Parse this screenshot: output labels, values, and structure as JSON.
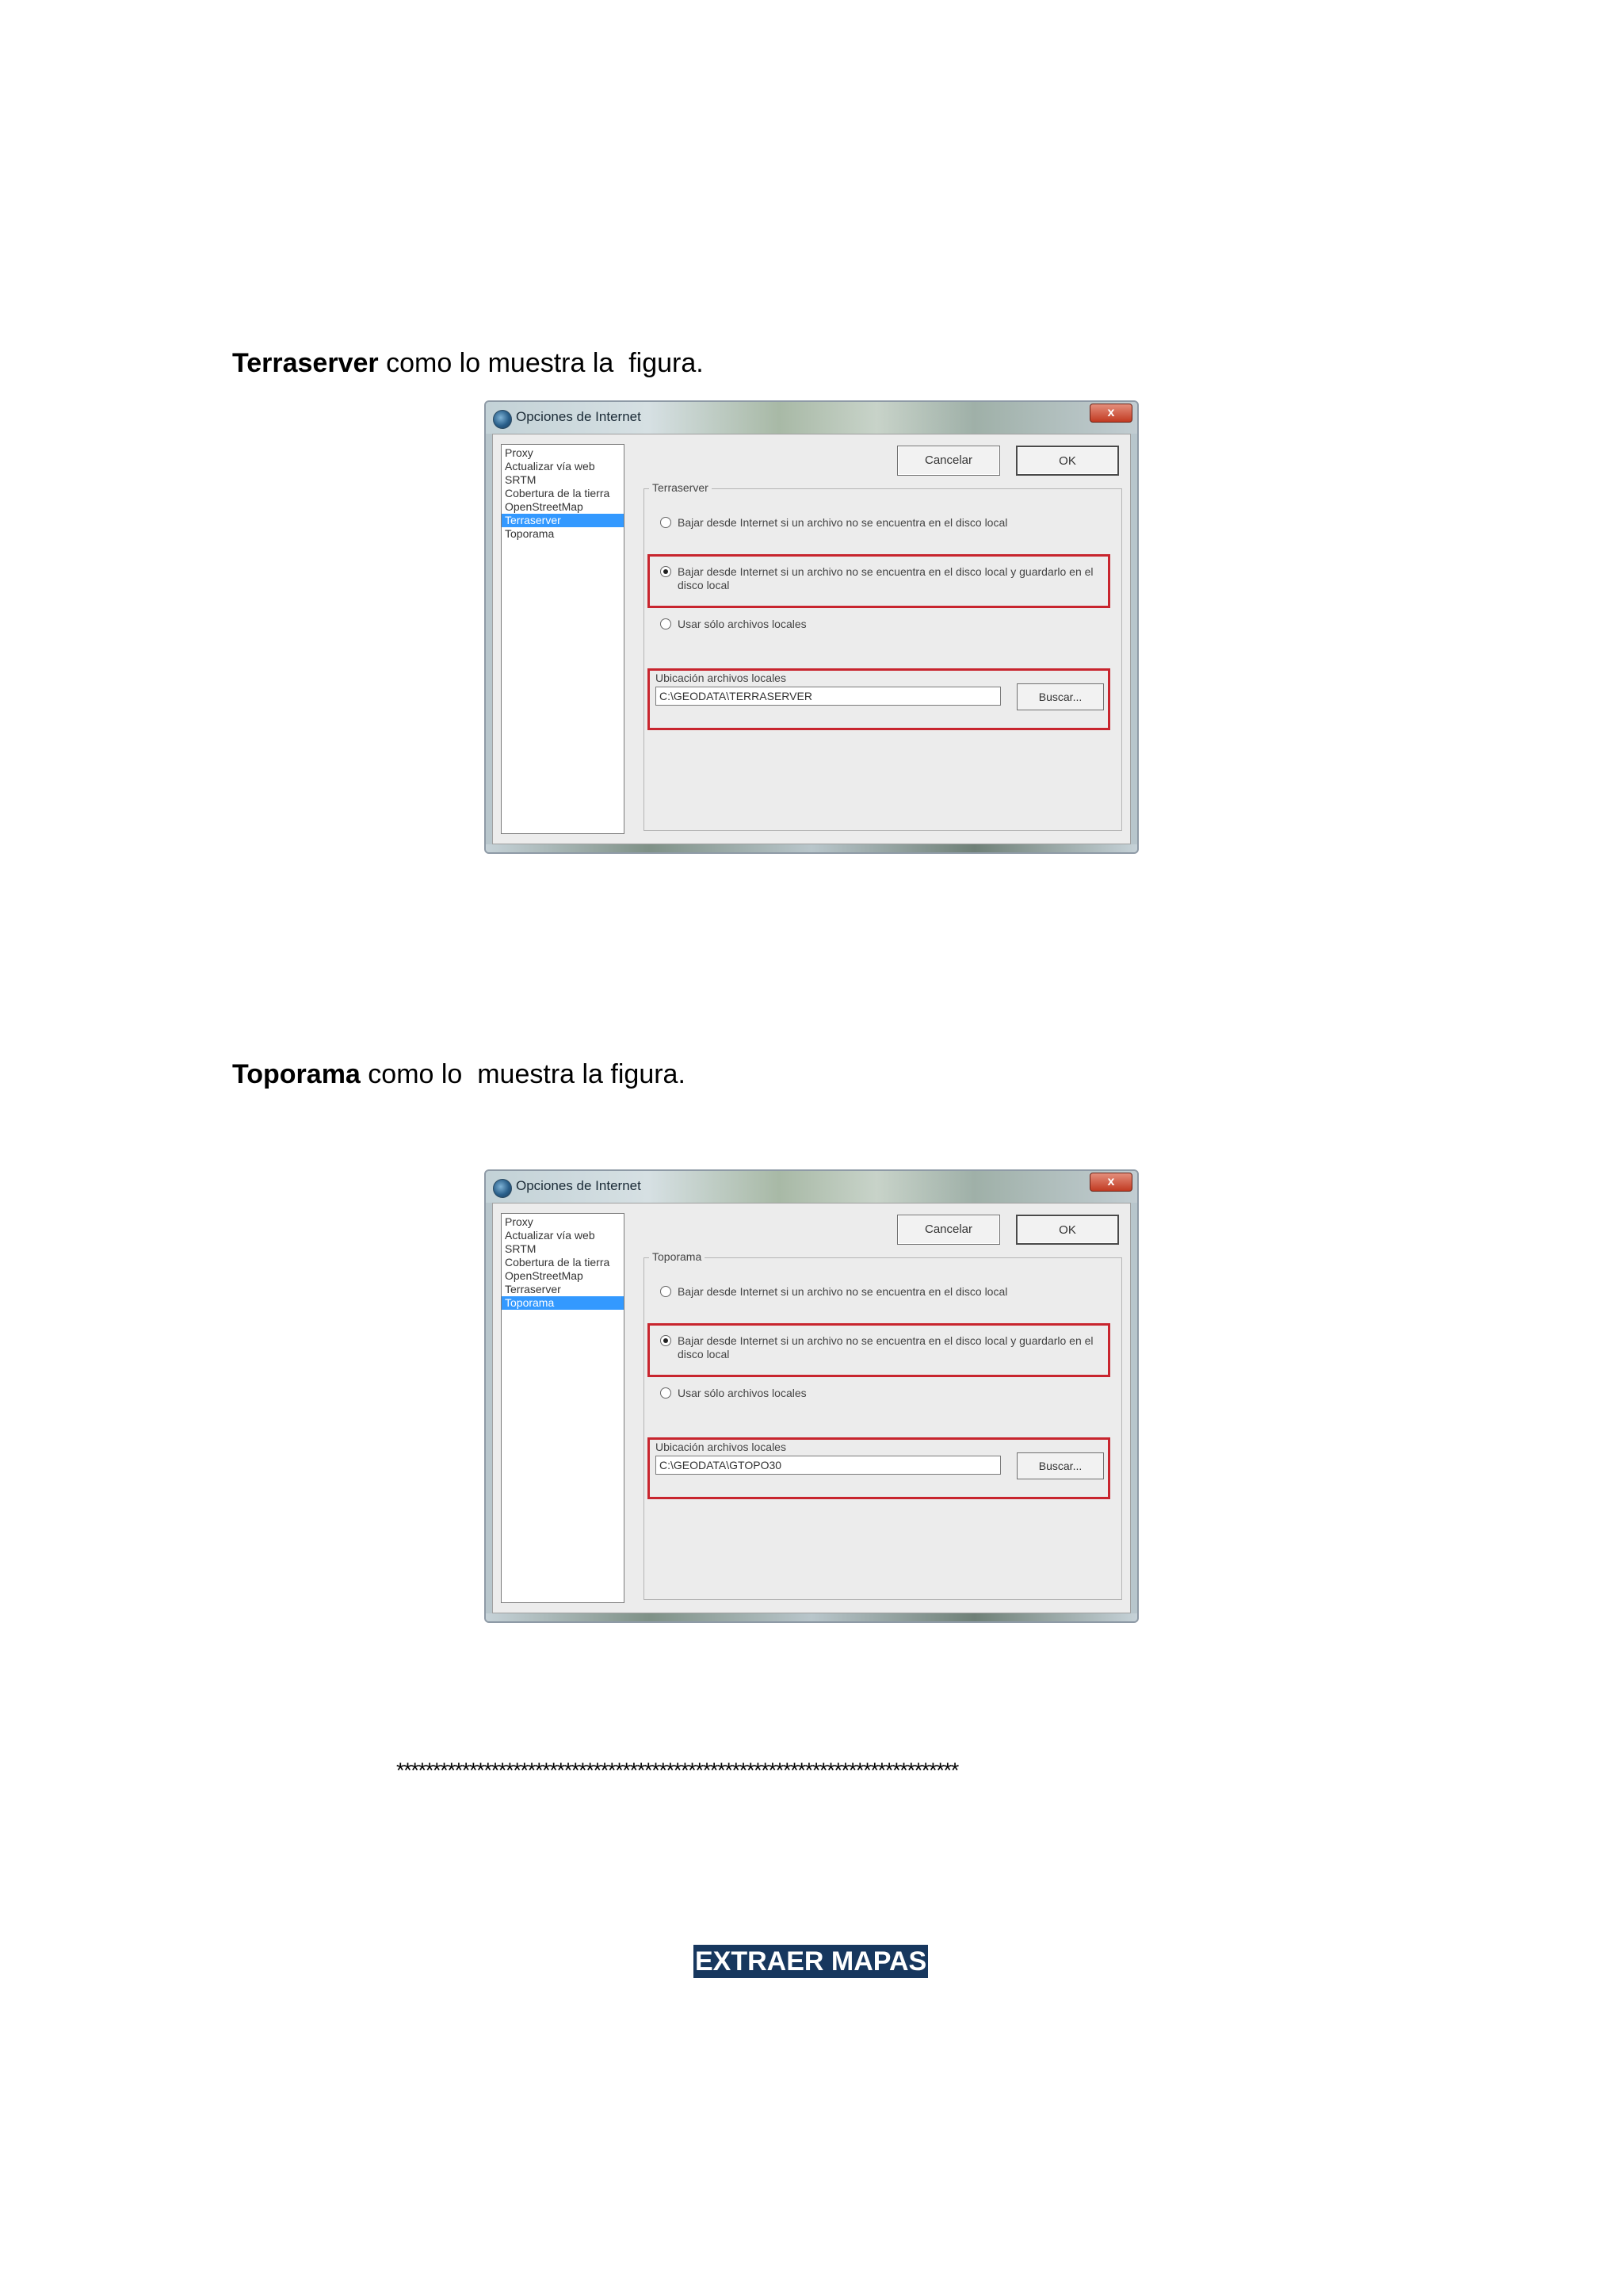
{
  "captions": [
    {
      "bold": "Terraserver",
      "rest": " como lo muestra la  figura."
    },
    {
      "bold": "Toporama",
      "rest": " como lo  muestra la figura."
    }
  ],
  "dialogs": [
    {
      "title": "Opciones de Internet",
      "close_label": "x",
      "nav_items": [
        "Proxy",
        "Actualizar vía web",
        "SRTM",
        "Cobertura de la tierra",
        "OpenStreetMap",
        "Terraserver",
        "Toporama"
      ],
      "selected_index": 5,
      "cancel_label": "Cancelar",
      "ok_label": "OK",
      "group_label": "Terraserver",
      "options": [
        "Bajar desde Internet si un archivo no se encuentra en el disco local",
        "Bajar desde Internet si un archivo no se encuentra en el disco local y guardarlo en el disco local",
        "Usar sólo archivos locales"
      ],
      "checked_option": 1,
      "location_label": "Ubicación archivos locales",
      "location_value": "C:\\GEODATA\\TERRASERVER",
      "browse_label": "Buscar..."
    },
    {
      "title": "Opciones de Internet",
      "close_label": "x",
      "nav_items": [
        "Proxy",
        "Actualizar vía web",
        "SRTM",
        "Cobertura de la tierra",
        "OpenStreetMap",
        "Terraserver",
        "Toporama"
      ],
      "selected_index": 6,
      "cancel_label": "Cancelar",
      "ok_label": "OK",
      "group_label": "Toporama",
      "options": [
        "Bajar desde Internet si un archivo no se encuentra en el disco local",
        "Bajar desde Internet si un archivo no se encuentra en el disco local y guardarlo en el disco local",
        "Usar sólo archivos locales"
      ],
      "checked_option": 1,
      "location_label": "Ubicación archivos locales",
      "location_value": "C:\\GEODATA\\GTOPO30",
      "browse_label": "Buscar..."
    }
  ],
  "separator": "*****************************************************************************",
  "section_heading": "EXTRAER MAPAS"
}
